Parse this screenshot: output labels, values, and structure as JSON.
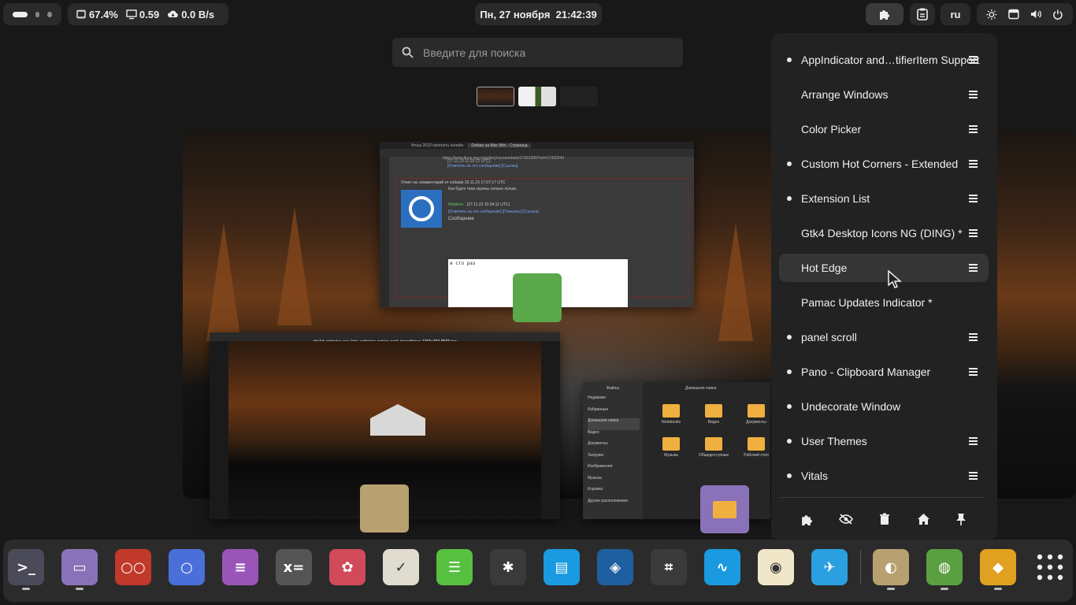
{
  "topbar": {
    "cpu": "67.4%",
    "load": "0.59",
    "net": "0.0 B/s",
    "clock": "Пн, 27 ноября  21:42:39",
    "lang": "ru"
  },
  "search": {
    "placeholder": "Введите для поиска"
  },
  "windows": {
    "browser_tab1": "Флэш 2023 смотреть онлайн",
    "browser_tab2": "Debian на Mac Mini - Страница",
    "browser_url": "https://www.linux.org.ru/gallery/screenshots/17421999?cid=17432944",
    "comment_meta": "(27.11.23 11:25:22 UTC)",
    "comment_link": "[Ответить на это сообщение] [Ссылка]",
    "reply_to": "Ответ на: комментарий от ezdatak 26.11.23 17:07:17 UTC",
    "reply_text": "Как будто твои скрины сильно лучше.",
    "author": "Wirelexx",
    "author_meta": "(27.11.23 10:34:11 UTC)",
    "author_links": "[Ответить на это сообщение] [Показать] [Ссылка]",
    "message_label": "Сообщение",
    "message_text": "и сто раз",
    "viewer_title": "chalet-amboise-see-lake-amboise-nature-park-riverafrmer-1366x768-8568.jpg",
    "files_app": "Файлы",
    "files_path": "Домашняя папка",
    "files_sidebar": [
      "Недавние",
      "Избранные",
      "Домашняя папка",
      "Видео",
      "Документы",
      "Загрузки",
      "Изображения",
      "Музыка",
      "Корзина",
      "Другие расположения"
    ],
    "files_folders": [
      "Notebooks",
      "Видео",
      "Документы",
      "Музыка",
      "Общедоступные",
      "Рабочий стол"
    ]
  },
  "extensions": [
    {
      "name": "AppIndicator and…tifierItem Support",
      "enabled": true,
      "prefs": true
    },
    {
      "name": "Arrange Windows",
      "enabled": false,
      "prefs": true
    },
    {
      "name": "Color Picker",
      "enabled": false,
      "prefs": true
    },
    {
      "name": "Custom Hot Corners - Extended",
      "enabled": true,
      "prefs": true
    },
    {
      "name": "Extension List",
      "enabled": true,
      "prefs": true
    },
    {
      "name": "Gtk4 Desktop Icons NG (DING) *",
      "enabled": false,
      "prefs": true
    },
    {
      "name": "Hot Edge",
      "enabled": false,
      "prefs": true
    },
    {
      "name": "Pamac Updates Indicator *",
      "enabled": false,
      "prefs": false
    },
    {
      "name": "panel scroll",
      "enabled": true,
      "prefs": true
    },
    {
      "name": "Pano - Clipboard Manager",
      "enabled": true,
      "prefs": true
    },
    {
      "name": "Undecorate Window",
      "enabled": true,
      "prefs": false
    },
    {
      "name": "User Themes",
      "enabled": true,
      "prefs": true
    },
    {
      "name": "Vitals",
      "enabled": true,
      "prefs": true
    }
  ],
  "dock": {
    "apps": [
      "terminal-app",
      "files-app",
      "office-app",
      "browser-app",
      "text-editor-app",
      "calculator-app",
      "image-viewer-app",
      "clipboard-app",
      "mindmap-app",
      "bee-app",
      "notes-app",
      "layers-app",
      "package-app",
      "system-monitor-app",
      "ghost-app",
      "telegram-app",
      "image-viewer-running-app",
      "maps-app",
      "stack-app"
    ],
    "colors": [
      "#4a4a58",
      "#8a72b8",
      "#c0392b",
      "#4a6fd8",
      "#9a55b8",
      "#555555",
      "#d04a5a",
      "#e0dcd0",
      "#58c040",
      "#3a3a3a",
      "#1a9ae0",
      "#1f5fa0",
      "#3a3a3a",
      "#1a9ae0",
      "#f0e6c8",
      "#2aa0e0",
      "#b8a070",
      "#5aa040",
      "#e0a020"
    ]
  }
}
